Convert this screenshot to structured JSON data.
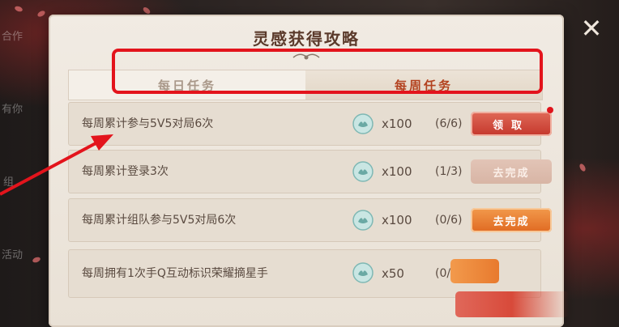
{
  "background": {
    "side_texts": [
      "合作",
      "有你",
      "组",
      "活动"
    ]
  },
  "panel": {
    "title": "灵感获得攻略",
    "tabs": [
      {
        "label": "每日任务",
        "active": false
      },
      {
        "label": "每周任务",
        "active": true
      }
    ]
  },
  "tasks": [
    {
      "text": "每周累计参与5V5对局6次",
      "reward": "x100",
      "progress": "(6/6)",
      "button": "领取",
      "state": "claim",
      "notify_dot": true
    },
    {
      "text": "每周累计登录3次",
      "reward": "x100",
      "progress": "(1/3)",
      "button": "去完成",
      "state": "disabled"
    },
    {
      "text": "每周累计组队参与5V5对局6次",
      "reward": "x100",
      "progress": "(0/6)",
      "button": "去完成",
      "state": "go"
    },
    {
      "text": "每周拥有1次手Q互动标识荣耀摘星手",
      "reward": "x50",
      "progress": "(0/1)",
      "button": "",
      "state": "partial"
    }
  ],
  "icons": {
    "close": "close-icon",
    "reward": "inspiration-coin-icon"
  },
  "colors": {
    "highlight": "#e3141c",
    "active_tab": "#b3421f",
    "go_button": "#e06a22",
    "claim_button": "#c4372c"
  }
}
